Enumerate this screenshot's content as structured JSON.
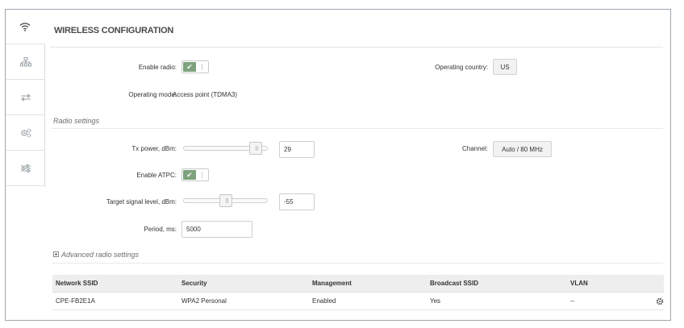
{
  "header": {
    "title": "WIRELESS CONFIGURATION"
  },
  "sidebar": {
    "items": [
      {
        "icon": "wifi-icon",
        "active": true
      },
      {
        "icon": "network-icon",
        "active": false
      },
      {
        "icon": "arrows-icon",
        "active": false
      },
      {
        "icon": "gears-icon",
        "active": false
      },
      {
        "icon": "sliders-icon",
        "active": false
      }
    ]
  },
  "general": {
    "enable_radio_label": "Enable radio:",
    "enable_radio_on": true,
    "operating_country_label": "Operating country:",
    "operating_country_value": "US",
    "operating_mode_label": "Operating mode:",
    "operating_mode_value": "Access point (TDMA3)"
  },
  "radio": {
    "section_title": "Radio settings",
    "tx_power_label": "Tx power, dBm:",
    "tx_power_value": "29",
    "tx_power_slider_fraction": 0.92,
    "channel_label": "Channel:",
    "channel_value": "Auto / 80 MHz",
    "enable_atpc_label": "Enable ATPC:",
    "enable_atpc_on": true,
    "target_signal_label": "Target signal level, dBm:",
    "target_signal_value": "-55",
    "target_signal_slider_fraction": 0.5,
    "period_label": "Period, ms:",
    "period_value": "5000"
  },
  "advanced": {
    "label": "Advanced radio settings"
  },
  "ssid_table": {
    "columns": [
      "Network SSID",
      "Security",
      "Management",
      "Broadcast SSID",
      "VLAN"
    ],
    "rows": [
      [
        "CPE-FB2E1A",
        "WPA2 Personal",
        "Enabled",
        "Yes",
        "--"
      ]
    ]
  },
  "colors": {
    "toggle_on": "#7da27d",
    "header_bg": "#eeeeee"
  }
}
